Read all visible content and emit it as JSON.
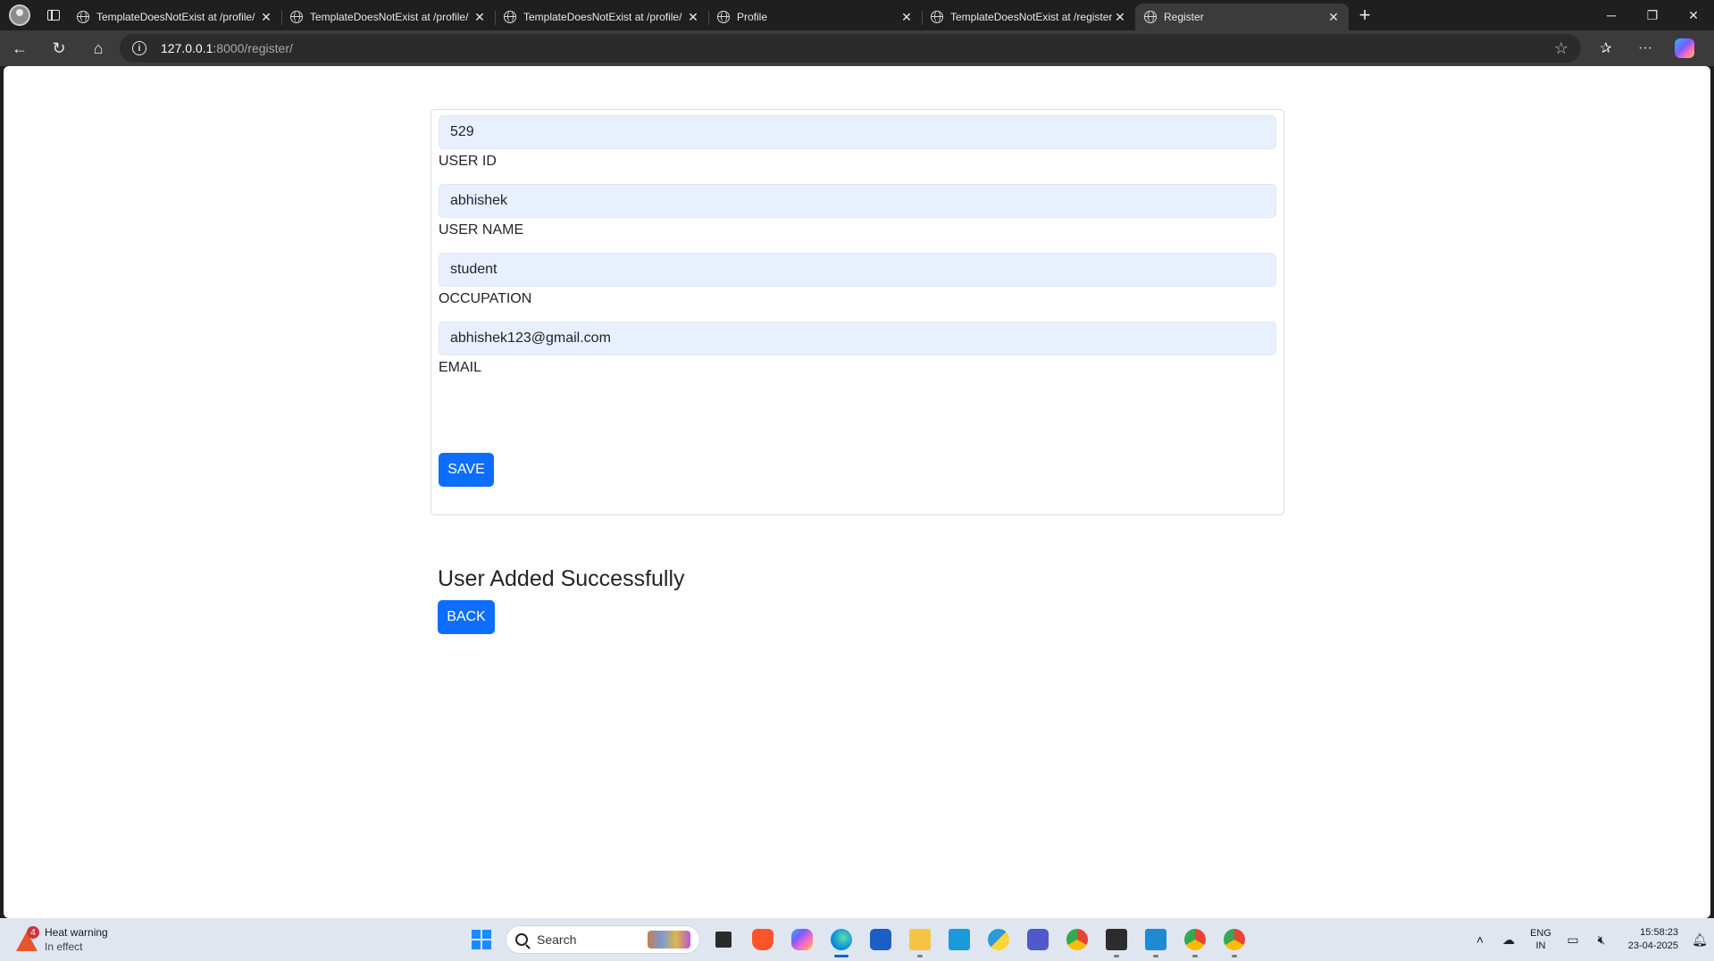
{
  "browser": {
    "tabs": [
      {
        "title": "TemplateDoesNotExist at /profile/"
      },
      {
        "title": "TemplateDoesNotExist at /profile/"
      },
      {
        "title": "TemplateDoesNotExist at /profile/"
      },
      {
        "title": "Profile"
      },
      {
        "title": "TemplateDoesNotExist at /register/"
      },
      {
        "title": "Register"
      }
    ],
    "url_host": "127.0.0.1",
    "url_rest": ":8000/register/"
  },
  "form": {
    "fields": [
      {
        "value": "529",
        "label": "USER ID"
      },
      {
        "value": "abhishek",
        "label": "USER NAME"
      },
      {
        "value": "student",
        "label": "OCCUPATION"
      },
      {
        "value": "abhishek123@gmail.com",
        "label": "EMAIL"
      }
    ],
    "save_label": "SAVE"
  },
  "message": {
    "text": "User Added Successfully",
    "back_label": "BACK"
  },
  "taskbar": {
    "weather_title": "Heat warning",
    "weather_sub": "In effect",
    "weather_badge": "4",
    "search_placeholder": "Search",
    "lang_top": "ENG",
    "lang_bottom": "IN",
    "time": "15:58:23",
    "date": "23-04-2025"
  },
  "colors": {
    "primary": "#0d6efd",
    "input_fill": "#e8f0fe",
    "chrome_dark": "#1f1f1f"
  }
}
